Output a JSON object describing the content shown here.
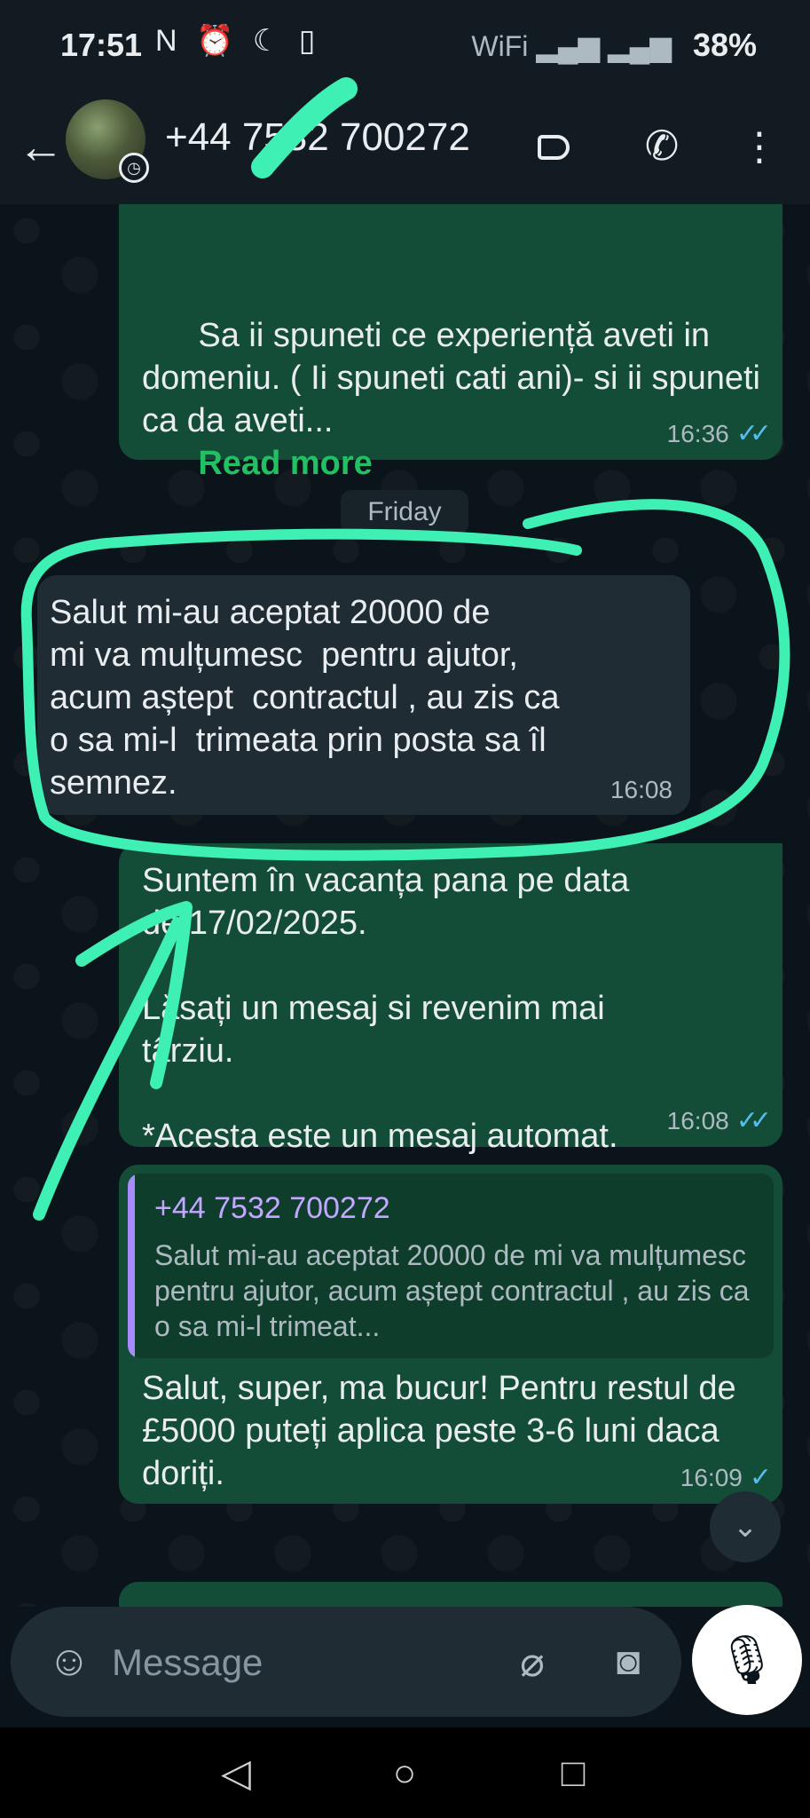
{
  "status_bar": {
    "time": "17:51",
    "left_icons": "N ⏰ ☾ ▯",
    "battery": "38%",
    "signal_icons": "WiFi ▂▄▆ ▂▄▆"
  },
  "header": {
    "contact": "+44 7532 700272"
  },
  "messages": [
    {
      "direction": "outgoing",
      "text": "Sa ii spuneti ce experiență aveti in domeniu. ( Ii spuneti cati ani)- si ii spuneti ca da aveti...",
      "read_more": "Read more",
      "time": "16:36",
      "ticks": "✓✓"
    },
    {
      "direction": "incoming",
      "text": "Salut mi-au aceptat 20000 de\nmi va mulțumesc  pentru ajutor,\nacum aștept  contractul , au zis ca\no sa mi-l  trimeata prin posta sa îl\nsemnez.",
      "time": "16:08"
    },
    {
      "direction": "outgoing",
      "text": "Suntem în vacanța pana pe data\nde 17/02/2025.\n\nLăsați un mesaj si revenim mai\ntârziu.\n\n*Acesta este un mesaj automat.",
      "time": "16:08",
      "ticks": "✓✓"
    },
    {
      "direction": "outgoing",
      "quote_author": "+44 7532 700272",
      "quote_text": "Salut mi-au aceptat 20000 de mi va mulțumesc  pentru ajutor, acum aștept contractul , au zis ca o sa mi-l  trimeat...",
      "text": "Salut, super, ma bucur! Pentru restul de £5000 puteți aplica peste 3-6 luni daca doriți.",
      "time": "16:09",
      "ticks": "✓"
    }
  ],
  "date_divider": "Friday",
  "composer": {
    "placeholder": "Message"
  },
  "colors": {
    "outgoing_bubble": "#144d37",
    "incoming_bubble": "#202c33",
    "accent_green": "#21c063",
    "annotation": "#3ef0b4"
  }
}
